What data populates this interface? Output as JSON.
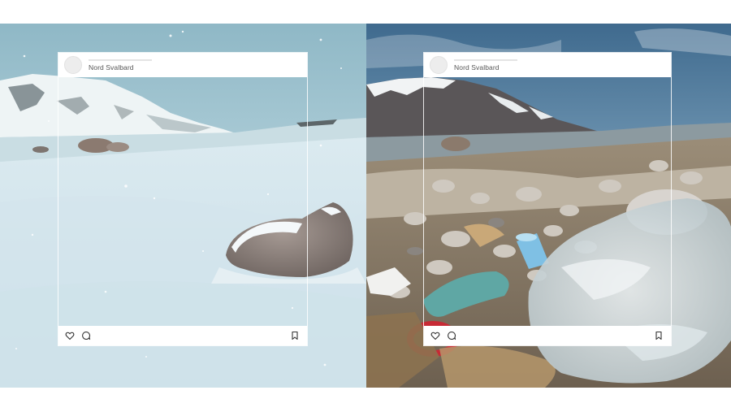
{
  "posts": [
    {
      "id": "left",
      "scene": "snowy arctic shore",
      "account_name": "Nord Svalbard",
      "icons": [
        "heart-icon",
        "comment-icon",
        "bookmark-icon"
      ]
    },
    {
      "id": "right",
      "scene": "polluted arctic shore",
      "account_name": "Nord Svalbard",
      "icons": [
        "heart-icon",
        "comment-icon",
        "bookmark-icon"
      ]
    }
  ],
  "colors": {
    "frame_border": "#ffffff",
    "header_bg": "#ffffff",
    "text": "#555555",
    "icon": "#333333"
  }
}
